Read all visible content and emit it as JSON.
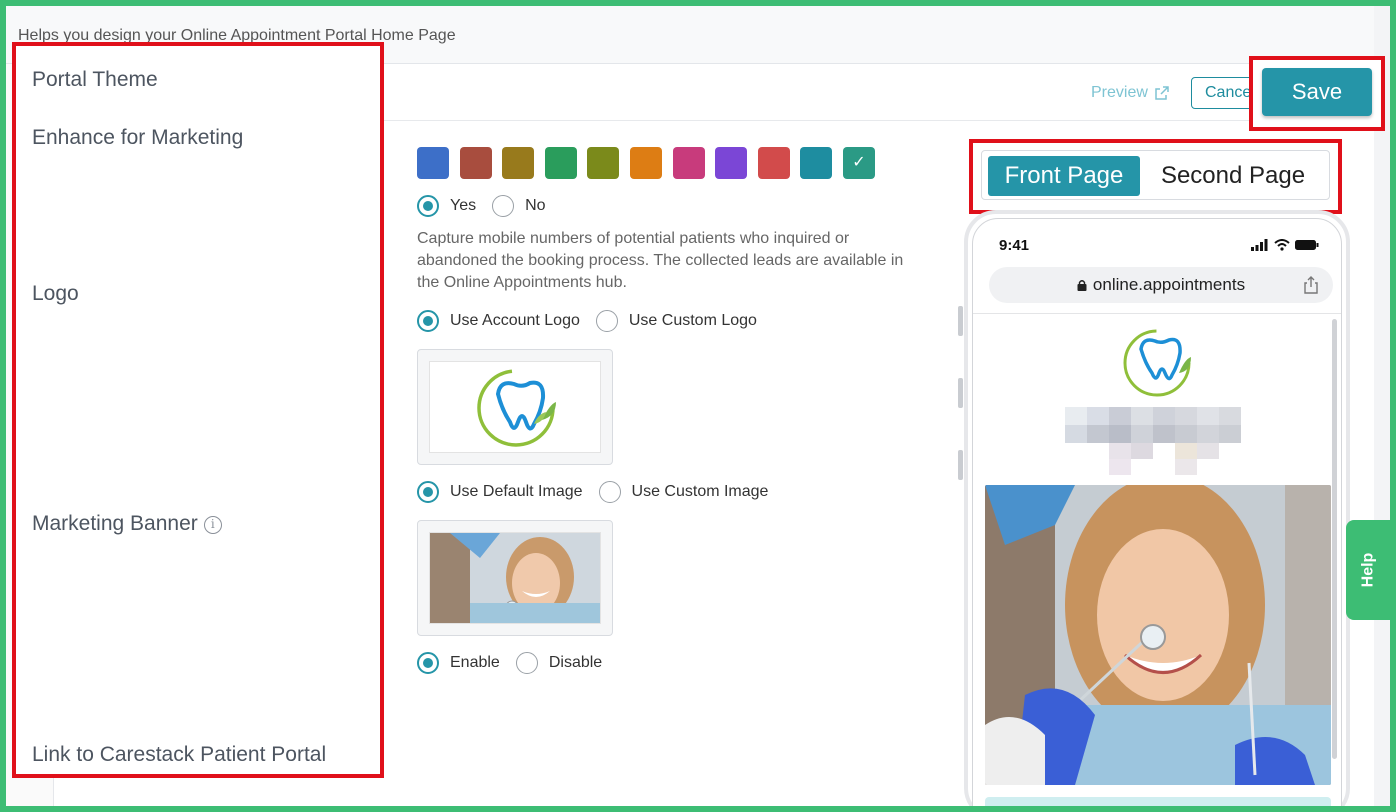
{
  "header": {
    "subtitle": "Helps you design your Online Appointment Portal Home Page",
    "preview_label": "Preview",
    "cancel_label": "Cancel",
    "save_label": "Save"
  },
  "sections": {
    "portal_theme": "Portal Theme",
    "enhance_marketing": "Enhance for Marketing",
    "logo": "Logo",
    "marketing_banner": "Marketing Banner",
    "patient_portal_link": "Link to Carestack Patient Portal"
  },
  "theme": {
    "swatches": [
      "#3d6fc8",
      "#a84d3e",
      "#987a1c",
      "#2a9d5c",
      "#7b8a1b",
      "#dd7d14",
      "#c83b7c",
      "#7b46d6",
      "#d24b4b",
      "#1e8da0",
      "#2b9a85"
    ],
    "selected_index": 10,
    "check_glyph": "✓"
  },
  "enhance": {
    "yes_label": "Yes",
    "no_label": "No",
    "selected": "yes",
    "description": "Capture mobile numbers of potential patients who inquired or abandoned the booking process. The collected leads are available in the Online Appointments hub."
  },
  "logo": {
    "account_label": "Use Account Logo",
    "custom_label": "Use Custom Logo",
    "selected": "account"
  },
  "banner": {
    "default_label": "Use Default Image",
    "custom_label": "Use Custom Image",
    "selected": "default"
  },
  "portal_link": {
    "enable_label": "Enable",
    "disable_label": "Disable",
    "selected": "enable"
  },
  "preview_tabs": {
    "front": "Front Page",
    "second": "Second Page",
    "active": "front"
  },
  "phone": {
    "time": "9:41",
    "url": "online.appointments"
  },
  "help_label": "Help",
  "colors": {
    "accent": "#2595a8",
    "highlight": "#e0101a",
    "help": "#3dbd74"
  }
}
